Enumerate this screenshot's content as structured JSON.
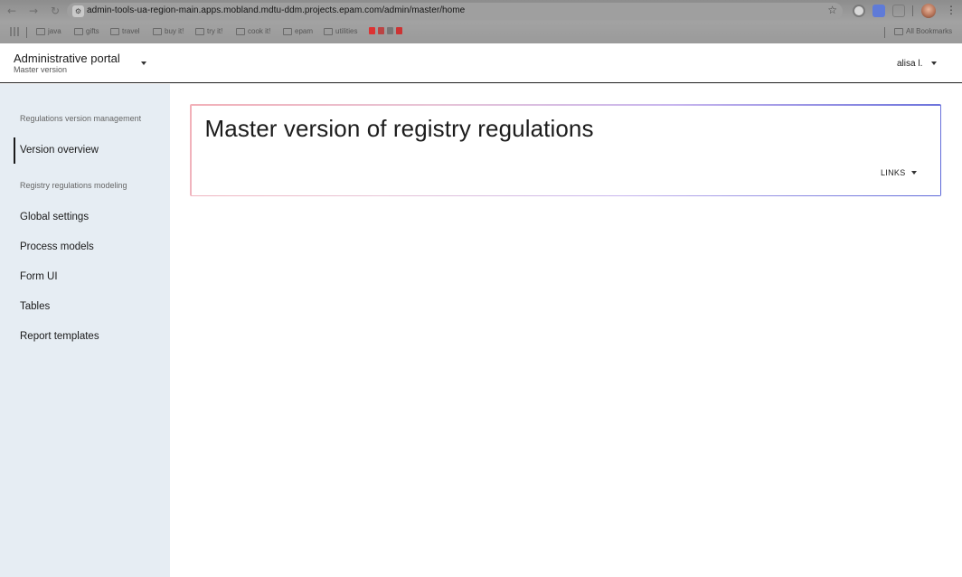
{
  "browser": {
    "url": "admin-tools-ua-region-main.apps.mobland.mdtu-ddm.projects.epam.com/admin/master/home",
    "bookmarks": [
      "java",
      "gifts",
      "travel",
      "buy it!",
      "try it!",
      "cook it!",
      "epam",
      "utilities"
    ],
    "all_bookmarks_label": "All Bookmarks"
  },
  "header": {
    "portal_title": "Administrative portal",
    "portal_subtitle": "Master version",
    "user_name": "alisa l."
  },
  "sidebar": {
    "section1": "Regulations version management",
    "section1_items": [
      "Version overview"
    ],
    "section2": "Registry regulations modeling",
    "section2_items": [
      "Global settings",
      "Process models",
      "Form UI",
      "Tables",
      "Report templates"
    ]
  },
  "main": {
    "title": "Master version of registry regulations",
    "links_label": "LINKS"
  },
  "colors": {
    "sidebar_bg": "#e6edf3",
    "card_gradient_start": "#f2b0b8",
    "card_gradient_end": "#5a66d8"
  }
}
